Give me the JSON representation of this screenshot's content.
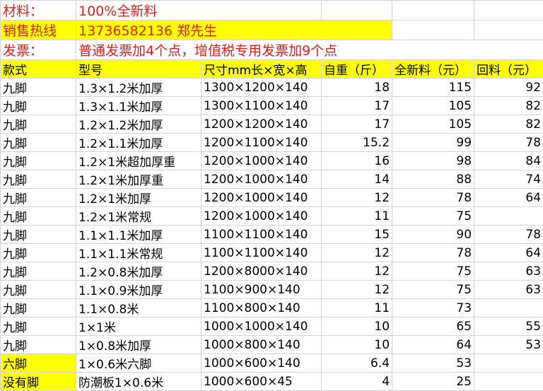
{
  "info": {
    "material_label": "材料：",
    "material_value": "100%全新料",
    "hotline_label": "销售热线",
    "hotline_value": "13736582136 郑先生",
    "invoice_label": "发票：",
    "invoice_value": "普通发票加4个点，增值税专用发票加9个点"
  },
  "headers": [
    "款式",
    "型号",
    "尺寸mm长×宽×高",
    "自重（斤）",
    "全新料（元）",
    "回料（元）"
  ],
  "rows": [
    {
      "style": "九脚",
      "model": "1.3×1.2米加厚",
      "size": "1300×1200×140",
      "weight": "18",
      "new": "115",
      "recycled": "92"
    },
    {
      "style": "九脚",
      "model": "1.3×1.1米加厚",
      "size": "1300×1100×140",
      "weight": "17",
      "new": "105",
      "recycled": "82"
    },
    {
      "style": "九脚",
      "model": "1.2×1.2米加厚",
      "size": "1200×1200×140",
      "weight": "17",
      "new": "105",
      "recycled": "82"
    },
    {
      "style": "九脚",
      "model": "1.2×1.1米加厚",
      "size": "1200×1100×140",
      "weight": "15.2",
      "new": "99",
      "recycled": "78"
    },
    {
      "style": "九脚",
      "model": "1.2×1米超加厚重",
      "size": "1200×1000×140",
      "weight": "16",
      "new": "98",
      "recycled": "84"
    },
    {
      "style": "九脚",
      "model": "1.2×1米加厚重",
      "size": "1200×1000×140",
      "weight": "14",
      "new": "88",
      "recycled": "74"
    },
    {
      "style": "九脚",
      "model": "1.2×1米加厚",
      "size": "1200×1000×140",
      "weight": "12",
      "new": "78",
      "recycled": "64"
    },
    {
      "style": "九脚",
      "model": "1.2×1米常规",
      "size": "1200×1000×140",
      "weight": "11",
      "new": "75",
      "recycled": ""
    },
    {
      "style": "九脚",
      "model": "1.1×1.1米加厚",
      "size": "1100×1100×140",
      "weight": "15",
      "new": "90",
      "recycled": "78"
    },
    {
      "style": "九脚",
      "model": "1.1×1.1米常规",
      "size": "1100×1100×140",
      "weight": "12",
      "new": "78",
      "recycled": "64"
    },
    {
      "style": "九脚",
      "model": "1.2×0.8米加厚",
      "size": "1200×8000×140",
      "weight": "12",
      "new": "75",
      "recycled": "63"
    },
    {
      "style": "九脚",
      "model": "1.1×0.9米加厚",
      "size": "1100×900×140",
      "weight": "12",
      "new": "75",
      "recycled": "63"
    },
    {
      "style": "九脚",
      "model": "1.1×0.8米",
      "size": "1100×800×140",
      "weight": "11",
      "new": "73",
      "recycled": ""
    },
    {
      "style": "九脚",
      "model": "1×1米",
      "size": "1000×1000×140",
      "weight": "10",
      "new": "65",
      "recycled": "55"
    },
    {
      "style": "九脚",
      "model": "1×0.8米加厚",
      "size": "1000×800×140",
      "weight": "10",
      "new": "64",
      "recycled": "53"
    },
    {
      "style": "六脚",
      "model": "1×0.6米六脚",
      "size": "1000×600×140",
      "weight": "6.4",
      "new": "53",
      "recycled": ""
    },
    {
      "style": "没有脚",
      "model": "防潮板1×0.6米",
      "size": "1000×600×45",
      "weight": "4",
      "new": "25",
      "recycled": ""
    }
  ],
  "colors": {
    "highlight": "#ffff00",
    "red_text": "#e02020",
    "grid": "#d4d4d4"
  }
}
